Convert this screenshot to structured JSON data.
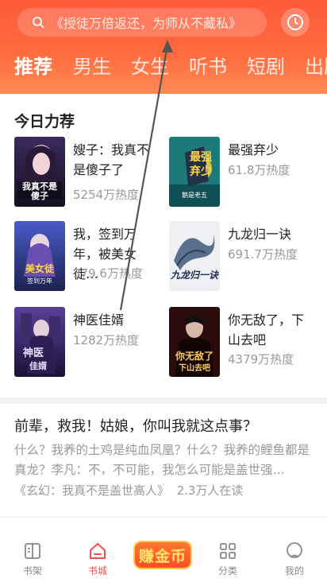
{
  "header": {
    "search_placeholder": "《授徒万倍返还，为师从不藏私》",
    "tabs": [
      "推荐",
      "男生",
      "女生",
      "听书",
      "短剧",
      "出版"
    ],
    "active_tab": "推荐"
  },
  "daily_picks": {
    "title": "今日力荐",
    "books": [
      {
        "title": "嫂子：我真不是傻子了",
        "heat": "5254万热度"
      },
      {
        "title": "最强弃少",
        "heat": "61.8万热度"
      },
      {
        "title": "我，签到万年，被美女徒…",
        "heat": "379.6万热度"
      },
      {
        "title": "九龙归一诀",
        "heat": "691.7万热度"
      },
      {
        "title": "神医佳婿",
        "heat": "1282万热度"
      },
      {
        "title": "你无敌了，下山去吧",
        "heat": "4379万热度"
      }
    ]
  },
  "article": {
    "title": "前辈，救我！姑娘，你叫我就这点事？",
    "description": "什么？我养的土鸡是纯血凤凰？什么？我养的鲤鱼都是真龙？李凡：不，不可能，我怎么可能是盖世强…",
    "book": "《玄幻：我真不是盖世高人》",
    "readers": "2.3万人在读"
  },
  "nav": {
    "items": [
      {
        "label": "书架",
        "icon": "bookshelf-icon"
      },
      {
        "label": "书城",
        "icon": "home-icon"
      },
      {
        "label": "赚金币",
        "icon": "coin-icon"
      },
      {
        "label": "分类",
        "icon": "category-grid-icon"
      },
      {
        "label": "我的",
        "icon": "profile-icon"
      }
    ],
    "active": "书城"
  },
  "colors": {
    "brand": "#ff5a3c",
    "active_nav": "#ff4a4a"
  }
}
